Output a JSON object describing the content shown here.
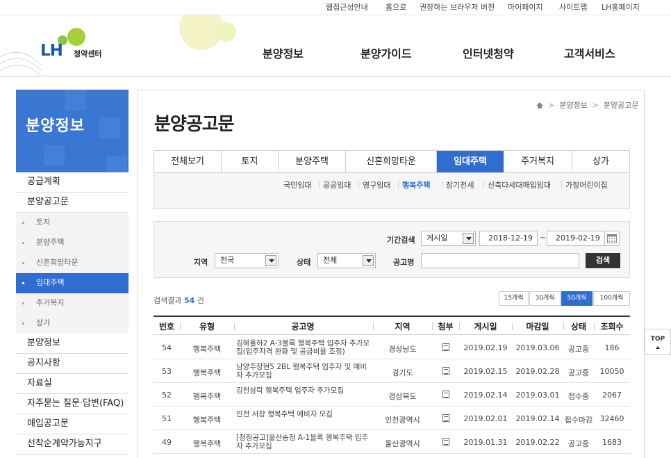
{
  "util_links": [
    "웹접근성안내",
    "홈으로",
    "권장하는 브라우저 버전",
    "마이페이지",
    "사이트맵",
    "LH홈페이지"
  ],
  "logo": {
    "brand": "LH",
    "center": "청약센터"
  },
  "gnb": [
    "분양정보",
    "분양가이드",
    "인터넷청약",
    "고객서비스"
  ],
  "sidebar": {
    "title": "분양정보",
    "items": [
      {
        "label": "공급계획",
        "type": "main"
      },
      {
        "label": "분양공고문",
        "type": "main"
      },
      {
        "label": "토지",
        "type": "sub"
      },
      {
        "label": "분양주택",
        "type": "sub"
      },
      {
        "label": "신혼희망타운",
        "type": "sub"
      },
      {
        "label": "임대주택",
        "type": "sub",
        "active": true
      },
      {
        "label": "주거복지",
        "type": "sub"
      },
      {
        "label": "상가",
        "type": "sub"
      },
      {
        "label": "분양정보",
        "type": "main"
      },
      {
        "label": "공지사항",
        "type": "main"
      },
      {
        "label": "자료실",
        "type": "main"
      },
      {
        "label": "자주묻는 질문·답변(FAQ)",
        "type": "main"
      },
      {
        "label": "매입공고문",
        "type": "main"
      },
      {
        "label": "선착순계약가능지구",
        "type": "main"
      }
    ]
  },
  "breadcrumb": {
    "level1": "분양정보",
    "level2": "분양공고문"
  },
  "page_title": "분양공고문",
  "tabs": [
    "전체보기",
    "토지",
    "분양주택",
    "신혼희망타운",
    "임대주택",
    "주거복지",
    "상가"
  ],
  "active_tab": "임대주택",
  "subtabs": [
    "국민임대",
    "공공임대",
    "영구임대",
    "행복주택",
    "장기전세",
    "신축다세대매입임대",
    "가정어린이집"
  ],
  "active_subtab": "행복주택",
  "search": {
    "period_label": "기간검색",
    "period_type": "게시일",
    "date_from": "2018-12-19",
    "date_sep": "~",
    "date_to": "2019-02-19",
    "region_label": "지역",
    "region_value": "전국",
    "status_label": "상태",
    "status_value": "전체",
    "title_label": "공고명",
    "title_value": "",
    "button": "검색"
  },
  "results": {
    "prefix": "검색결과",
    "count": "54",
    "suffix": "건"
  },
  "page_sizes": [
    "15개씩",
    "30개씩",
    "50개씩",
    "100개씩"
  ],
  "active_page_size": "50개씩",
  "table": {
    "headers": [
      "번호",
      "유형",
      "공고명",
      "지역",
      "첨부",
      "게시일",
      "마감일",
      "상태",
      "조회수"
    ],
    "rows": [
      {
        "no": "54",
        "type": "행복주택",
        "title": "김해율하2 A-3블록 행복주택 입주자 추가모집(입주자격 완화 및 공급비율 조정)",
        "region": "경상남도",
        "posted": "2019.02.19",
        "deadline": "2019.03.06",
        "status": "공고중",
        "views": "186"
      },
      {
        "no": "53",
        "type": "행복주택",
        "title": "남양주장현5 2BL 행복주택 입주자 및 예비자 추가모집",
        "region": "경기도",
        "posted": "2019.02.15",
        "deadline": "2019.02.28",
        "status": "공고중",
        "views": "10050"
      },
      {
        "no": "52",
        "type": "행복주택",
        "title": "김천삼락 행복주택 입주자 추가모집",
        "region": "경상북도",
        "posted": "2019.02.14",
        "deadline": "2019.03.01",
        "status": "접수중",
        "views": "2067"
      },
      {
        "no": "51",
        "type": "행복주택",
        "title": "인천 서창 행복주택 예비자 모집",
        "region": "인천광역시",
        "posted": "2019.02.01",
        "deadline": "2019.02.14",
        "status": "접수마감",
        "views": "32460"
      },
      {
        "no": "49",
        "type": "행복주택",
        "title": "[정정공고]울산송정 A-1블록 행복주택 입주자 추가모집",
        "region": "울산광역시",
        "posted": "2019.01.31",
        "deadline": "2019.02.22",
        "status": "공고중",
        "views": "1683"
      }
    ]
  },
  "top_button": "TOP",
  "colors": {
    "primary": "#2f6ed0",
    "sidebar_title_bg": "#3a77d3",
    "lime": "#8cc63f"
  }
}
